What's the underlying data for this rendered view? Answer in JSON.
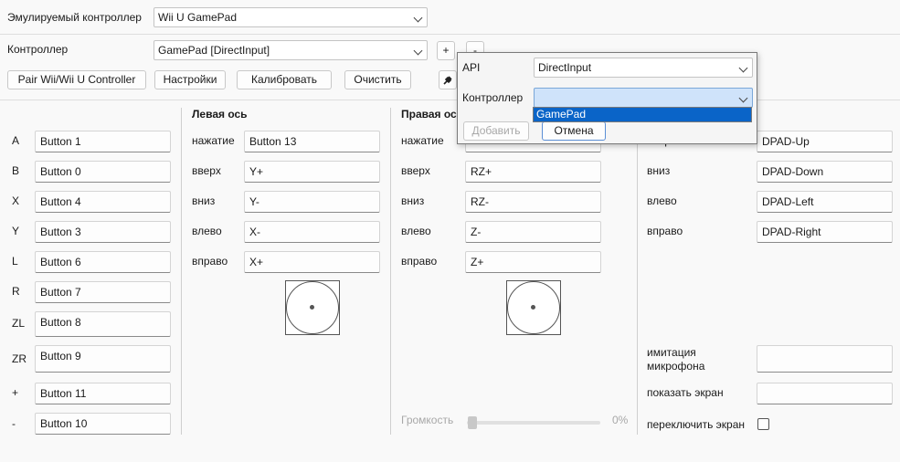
{
  "emulated_label": "Эмулируемый контроллер",
  "emulated_value": "Wii U GamePad",
  "controller_label": "Контроллер",
  "controller_value": "GamePad [DirectInput]",
  "plus_label": "+",
  "minus_label": "-",
  "buttons": {
    "pair": "Pair Wii/Wii U Controller",
    "settings": "Настройки",
    "calibrate": "Калибровать",
    "clear": "Очистить"
  },
  "mappings": [
    {
      "key": "A",
      "value": "Button 1"
    },
    {
      "key": "B",
      "value": "Button 0"
    },
    {
      "key": "X",
      "value": "Button 4"
    },
    {
      "key": "Y",
      "value": "Button 3"
    },
    {
      "key": "L",
      "value": "Button 6"
    },
    {
      "key": "R",
      "value": "Button 7"
    },
    {
      "key": "ZL",
      "value": "Button 8"
    },
    {
      "key": "ZR",
      "value": "Button 9"
    },
    {
      "key": "+",
      "value": "Button 11"
    },
    {
      "key": "-",
      "value": "Button 10"
    }
  ],
  "left_axis": {
    "title": "Левая ось",
    "rows": [
      {
        "key": "нажатие",
        "value": "Button 13"
      },
      {
        "key": "вверх",
        "value": "Y+"
      },
      {
        "key": "вниз",
        "value": "Y-"
      },
      {
        "key": "влево",
        "value": "X-"
      },
      {
        "key": "вправо",
        "value": "X+"
      }
    ]
  },
  "right_axis": {
    "title": "Правая ось",
    "rows": [
      {
        "key": "нажатие",
        "value": ""
      },
      {
        "key": "вверх",
        "value": "RZ+"
      },
      {
        "key": "вниз",
        "value": "RZ-"
      },
      {
        "key": "влево",
        "value": "Z-"
      },
      {
        "key": "вправо",
        "value": "Z+"
      }
    ]
  },
  "volume": {
    "label": "Громкость",
    "value": "0%"
  },
  "dpad": {
    "rows": [
      {
        "key": "вверх",
        "value": "DPAD-Up"
      },
      {
        "key": "вниз",
        "value": "DPAD-Down"
      },
      {
        "key": "влево",
        "value": "DPAD-Left"
      },
      {
        "key": "вправо",
        "value": "DPAD-Right"
      }
    ]
  },
  "extras": {
    "mic_label": "имитация\nмикрофона",
    "show_screen_label": "показать экран",
    "toggle_screen_label": "переключить экран"
  },
  "popup": {
    "api_label": "API",
    "api_value": "DirectInput",
    "controller_label": "Контроллер",
    "controller_value": "",
    "dropdown_option": "GamePad",
    "add_label": "Добавить",
    "cancel_label": "Отмена"
  }
}
